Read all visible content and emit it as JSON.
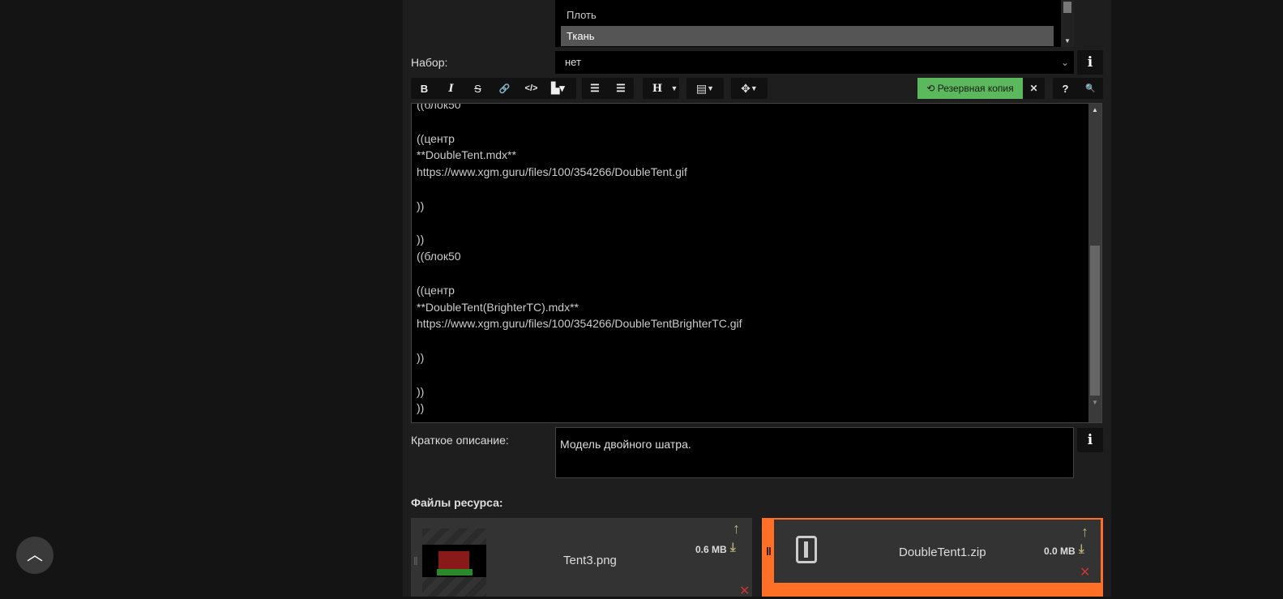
{
  "material_list": {
    "options": [
      "Плоть",
      "Ткань"
    ],
    "selected": "Ткань"
  },
  "set": {
    "label": "Набор:",
    "value": "нет",
    "info": "i"
  },
  "toolbar": {
    "bold": "B",
    "italic": "I",
    "strike": "S",
    "link": "🔗",
    "code": "</>",
    "heading": "H",
    "backup_label": "Резервная копия",
    "close": "✕",
    "help": "?",
    "search": "🔍"
  },
  "editor": {
    "content": "((блок50\n\n((центр\n**DoubleTent.mdx**\nhttps://www.xgm.guru/files/100/354266/DoubleTent.gif\n\n))\n\n))\n((блок50\n\n((центр\n**DoubleTent(BrighterTC).mdx**\nhttps://www.xgm.guru/files/100/354266/DoubleTentBrighterTC.gif\n\n))\n\n))\n))"
  },
  "short_desc": {
    "label": "Краткое описание:",
    "value": "Модель двойного шатра.",
    "info": "i"
  },
  "files": {
    "heading": "Файлы ресурса:",
    "items": [
      {
        "name": "Tent3.png",
        "size": "0.6 MB"
      },
      {
        "name": "DoubleTent1.zip",
        "size": "0.0 MB"
      }
    ]
  },
  "colors": {
    "accent": "#ff6f26",
    "backup": "#5cb85c"
  }
}
